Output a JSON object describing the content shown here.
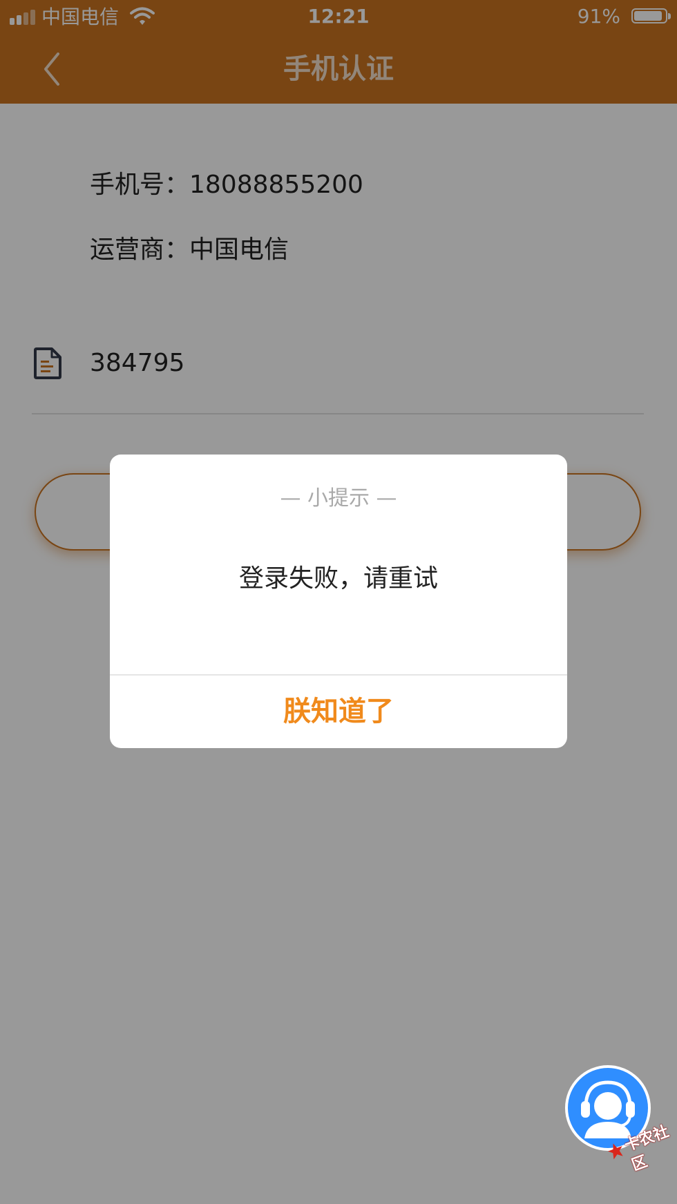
{
  "status_bar": {
    "carrier": "中国电信",
    "time": "12:21",
    "battery": "91%"
  },
  "nav": {
    "title": "手机认证",
    "back_icon": "chevron-left-icon"
  },
  "info": {
    "phone_line": "手机号：18088855200",
    "operator_line": "运营商：中国电信"
  },
  "verification": {
    "icon": "document-icon",
    "value": "384795"
  },
  "dialog": {
    "title": "— 小提示 —",
    "message": "登录失败，请重试",
    "button_label": "朕知道了"
  },
  "watermark": {
    "text": "卡农社区"
  },
  "colors": {
    "brand": "#ca7421",
    "dialog_button": "#f08a1c",
    "support_button": "#2f8eff"
  }
}
